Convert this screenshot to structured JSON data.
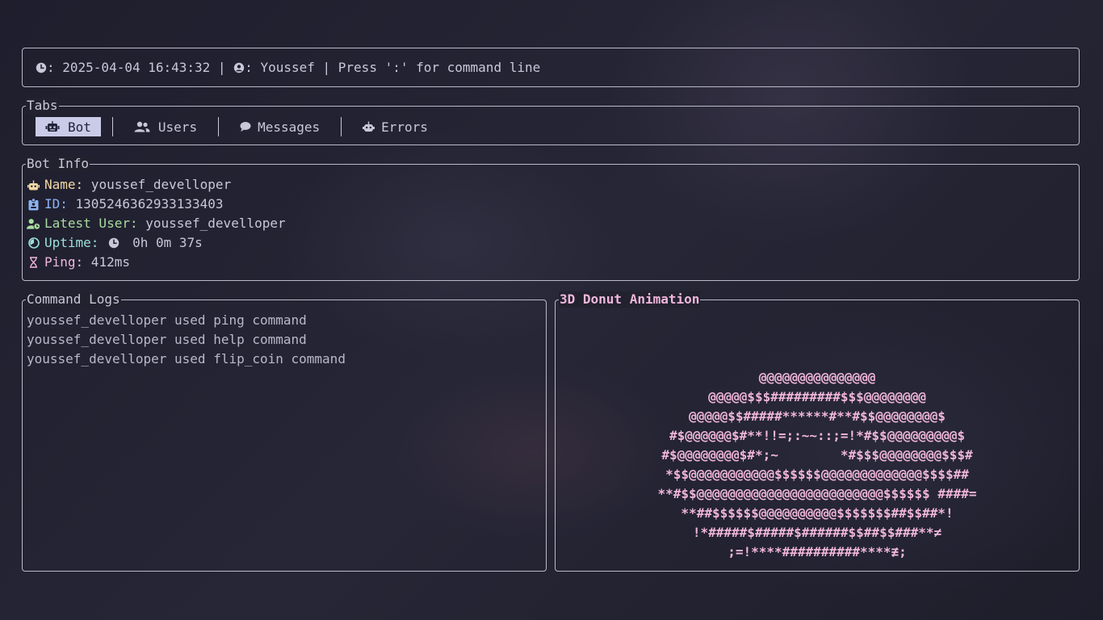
{
  "status_bar": {
    "time_label": ": 2025-04-04 16:43:32 | ",
    "user_label": ": Youssef | Press ':' for command line"
  },
  "tabs": {
    "title": "Tabs",
    "items": [
      {
        "label": "Bot",
        "icon": "robot-icon",
        "active": true
      },
      {
        "label": "Users",
        "icon": "users-icon",
        "active": false
      },
      {
        "label": "Messages",
        "icon": "chat-bubble-icon",
        "active": false
      },
      {
        "label": "Errors",
        "icon": "bug-icon",
        "active": false
      }
    ]
  },
  "bot_info": {
    "title": "Bot Info",
    "name": {
      "label": "Name:",
      "value": " youssef_develloper",
      "color": "#f3d9a6"
    },
    "id": {
      "label": "ID:",
      "value": " 1305246362933133403",
      "color": "#8db3f0"
    },
    "latest_user": {
      "label": "Latest User:",
      "value": " youssef_develloper",
      "color": "#a9dca0"
    },
    "uptime": {
      "label": "Uptime:",
      "value": " 0h 0m 37s",
      "color": "#9be0d6"
    },
    "ping": {
      "label": "Ping:",
      "value": " 412ms",
      "color": "#f0b6da"
    }
  },
  "command_logs": {
    "title": "Command Logs",
    "entries": [
      "youssef_develloper used ping command",
      "youssef_develloper used help command",
      "youssef_develloper used flip_coin command"
    ]
  },
  "donut": {
    "title": "3D Donut Animation",
    "lines": [
      "@@@@@@@@@@@@@@@",
      "@@@@@$$$#########$$$@@@@@@@@",
      "@@@@@$$#####******#**#$$@@@@@@@@$",
      "#$@@@@@@$#**!!=;:~~::;=!*#$$@@@@@@@@@$",
      "#$@@@@@@@@$#*;~        *#$$$@@@@@@@@$$$#",
      "*$$@@@@@@@@@@@$$$$$$@@@@@@@@@@@@@$$$$##",
      "**#$$@@@@@@@@@@@@@@@@@@@@@@@@$$$$$$ ####=",
      "**##$$$$$$@@@@@@@@@@$$$$$$$##$$##*!",
      "!*#####$#####$######$$##$$###**≠",
      ";=!****##########****≢;"
    ]
  },
  "colors": {
    "background": "#20202f",
    "border": "#b9bac8",
    "text": "#c7c9d8",
    "active_tab_bg": "#c9cbe8",
    "donut": "#f0b6da"
  }
}
